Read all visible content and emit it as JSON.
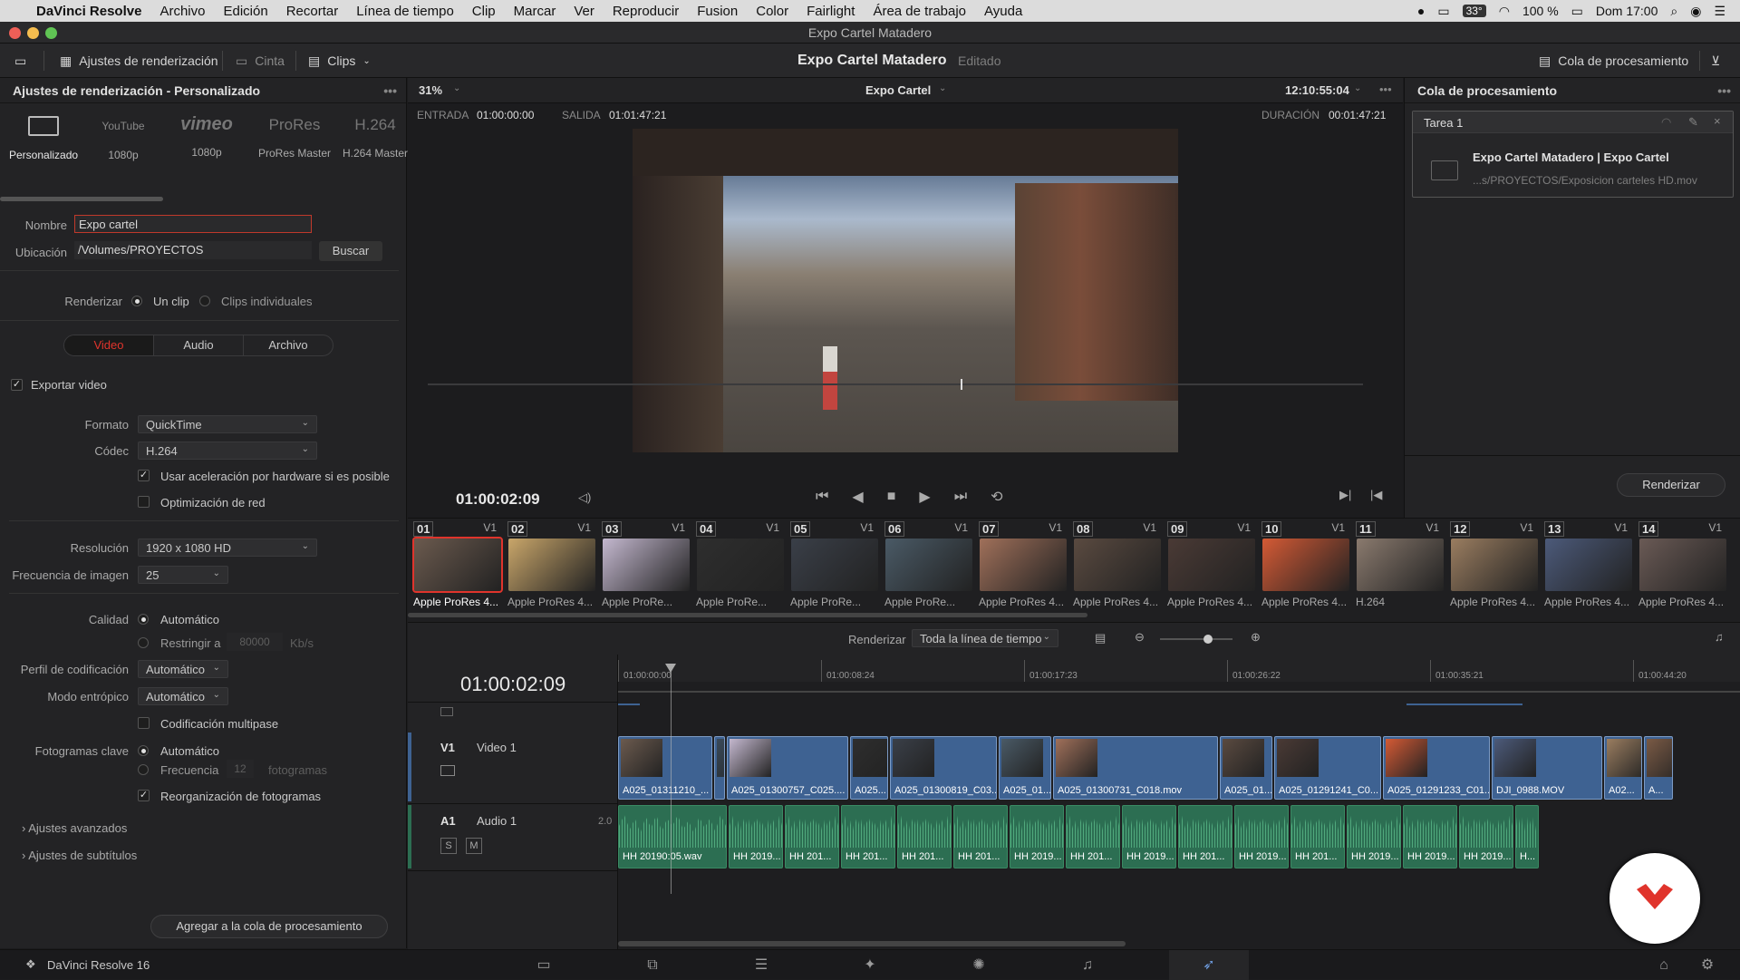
{
  "menubar": {
    "apple_icon": "apple-logo",
    "items": [
      "DaVinci Resolve",
      "Archivo",
      "Edición",
      "Recortar",
      "Línea de tiempo",
      "Clip",
      "Marcar",
      "Ver",
      "Reproducir",
      "Fusion",
      "Color",
      "Fairlight",
      "Área de trabajo",
      "Ayuda"
    ],
    "status": {
      "temp": "33°",
      "battery": "100 %",
      "datetime": "Dom 17:00"
    }
  },
  "window": {
    "title": "Expo Cartel Matadero"
  },
  "toolbar": {
    "render_settings": "Ajustes de renderización",
    "tape": "Cinta",
    "clips": "Clips",
    "project_title": "Expo Cartel Matadero",
    "project_status": "Editado",
    "render_queue": "Cola de procesamiento"
  },
  "left": {
    "header": "Ajustes de renderización - Personalizado",
    "presets": [
      {
        "name": "",
        "label": "Personalizado"
      },
      {
        "name": "YouTube",
        "label": "1080p"
      },
      {
        "name": "vimeo",
        "label": "1080p"
      },
      {
        "name": "ProRes",
        "label": "ProRes Master"
      },
      {
        "name": "H.264",
        "label": "H.264 Master"
      }
    ],
    "name_label": "Nombre",
    "name_value": "Expo cartel",
    "location_label": "Ubicación",
    "location_value": "/Volumes/PROYECTOS",
    "browse": "Buscar",
    "render_label": "Renderizar",
    "single_clip": "Un clip",
    "individual_clips": "Clips individuales",
    "tabs": [
      "Video",
      "Audio",
      "Archivo"
    ],
    "export_video": "Exportar video",
    "format_label": "Formato",
    "format_value": "QuickTime",
    "codec_label": "Códec",
    "codec_value": "H.264",
    "hw_accel": "Usar aceleración por hardware si es posible",
    "network_opt": "Optimización de red",
    "resolution_label": "Resolución",
    "resolution_value": "1920 x 1080 HD",
    "framerate_label": "Frecuencia de imagen",
    "framerate_value": "25",
    "quality_label": "Calidad",
    "quality_auto": "Automático",
    "restrict_to": "Restringir a",
    "restrict_value": "80000",
    "restrict_unit": "Kb/s",
    "encoding_profile_label": "Perfil de codificación",
    "encoding_profile_value": "Automático",
    "entropy_label": "Modo entrópico",
    "entropy_value": "Automático",
    "multipass": "Codificación multipase",
    "keyframes_label": "Fotogramas clave",
    "keyframes_auto": "Automático",
    "keyframes_freq": "Frecuencia",
    "keyframes_value": "12",
    "keyframes_unit": "fotogramas",
    "reorder": "Reorganización de fotogramas",
    "advanced": "Ajustes avanzados",
    "subtitles": "Ajustes de subtítulos",
    "add_to_queue": "Agregar a la cola de procesamiento"
  },
  "viewer": {
    "zoom": "31%",
    "timeline_name": "Expo Cartel",
    "timecode_top": "12:10:55:04",
    "in_label": "ENTRADA",
    "in_value": "01:00:00:00",
    "out_label": "SALIDA",
    "out_value": "01:01:47:21",
    "duration_label": "DURACIÓN",
    "duration_value": "00:01:47:21",
    "current_tc": "01:00:02:09"
  },
  "queue": {
    "header": "Cola de procesamiento",
    "job_title": "Tarea 1",
    "job_name": "Expo Cartel Matadero | Expo Cartel",
    "job_path": "...s/PROYECTOS/Exposicion carteles HD.mov",
    "render_button": "Renderizar"
  },
  "clips": [
    {
      "num": "01",
      "track": "V1",
      "codec": "Apple ProRes 4..."
    },
    {
      "num": "02",
      "track": "V1",
      "codec": "Apple ProRes 4..."
    },
    {
      "num": "03",
      "track": "V1",
      "codec": "Apple ProRe..."
    },
    {
      "num": "04",
      "track": "V1",
      "codec": "Apple ProRe..."
    },
    {
      "num": "05",
      "track": "V1",
      "codec": "Apple ProRe..."
    },
    {
      "num": "06",
      "track": "V1",
      "codec": "Apple ProRe..."
    },
    {
      "num": "07",
      "track": "V1",
      "codec": "Apple ProRes 4..."
    },
    {
      "num": "08",
      "track": "V1",
      "codec": "Apple ProRes 4..."
    },
    {
      "num": "09",
      "track": "V1",
      "codec": "Apple ProRes 4..."
    },
    {
      "num": "10",
      "track": "V1",
      "codec": "Apple ProRes 4..."
    },
    {
      "num": "11",
      "track": "V1",
      "codec": "H.264"
    },
    {
      "num": "12",
      "track": "V1",
      "codec": "Apple ProRes 4..."
    },
    {
      "num": "13",
      "track": "V1",
      "codec": "Apple ProRes 4..."
    },
    {
      "num": "14",
      "track": "V1",
      "codec": "Apple ProRes 4..."
    }
  ],
  "renderbar": {
    "label": "Renderizar",
    "value": "Toda la línea de tiempo"
  },
  "timeline": {
    "timecode": "01:00:02:09",
    "ruler": [
      "01:00:00:00",
      "01:00:08:24",
      "01:00:17:23",
      "01:00:26:22",
      "01:00:35:21",
      "01:00:44:20"
    ],
    "v1_label": "V1",
    "v1_name": "Video 1",
    "a1_label": "A1",
    "a1_name": "Audio 1",
    "a1_channels": "2.0",
    "solo": "S",
    "mute": "M",
    "video_clips": [
      "A025_01311210_...",
      "",
      "A025_01300757_C025....",
      "A025...",
      "A025_01300819_C03...",
      "A025_01...",
      "A025_01300731_C018.mov",
      "A025_01...",
      "A025_01291241_C0...",
      "A025_01291233_C01...",
      "DJI_0988.MOV",
      "A02...",
      "A..."
    ],
    "audio_clips": [
      "HH 20190:05.wav",
      "HH 2019...",
      "HH 201...",
      "HH 201...",
      "HH 201...",
      "HH 201...",
      "HH 2019...",
      "HH 201...",
      "HH 2019...",
      "HH 201...",
      "HH 2019...",
      "HH 201...",
      "HH 2019...",
      "HH 2019...",
      "HH 2019...",
      "H..."
    ]
  },
  "bottom": {
    "app_name": "DaVinci Resolve 16"
  },
  "colors": {
    "accent_red": "#e0342c",
    "clip_blue": "#3e6292",
    "audio_green": "#2c6e52"
  }
}
